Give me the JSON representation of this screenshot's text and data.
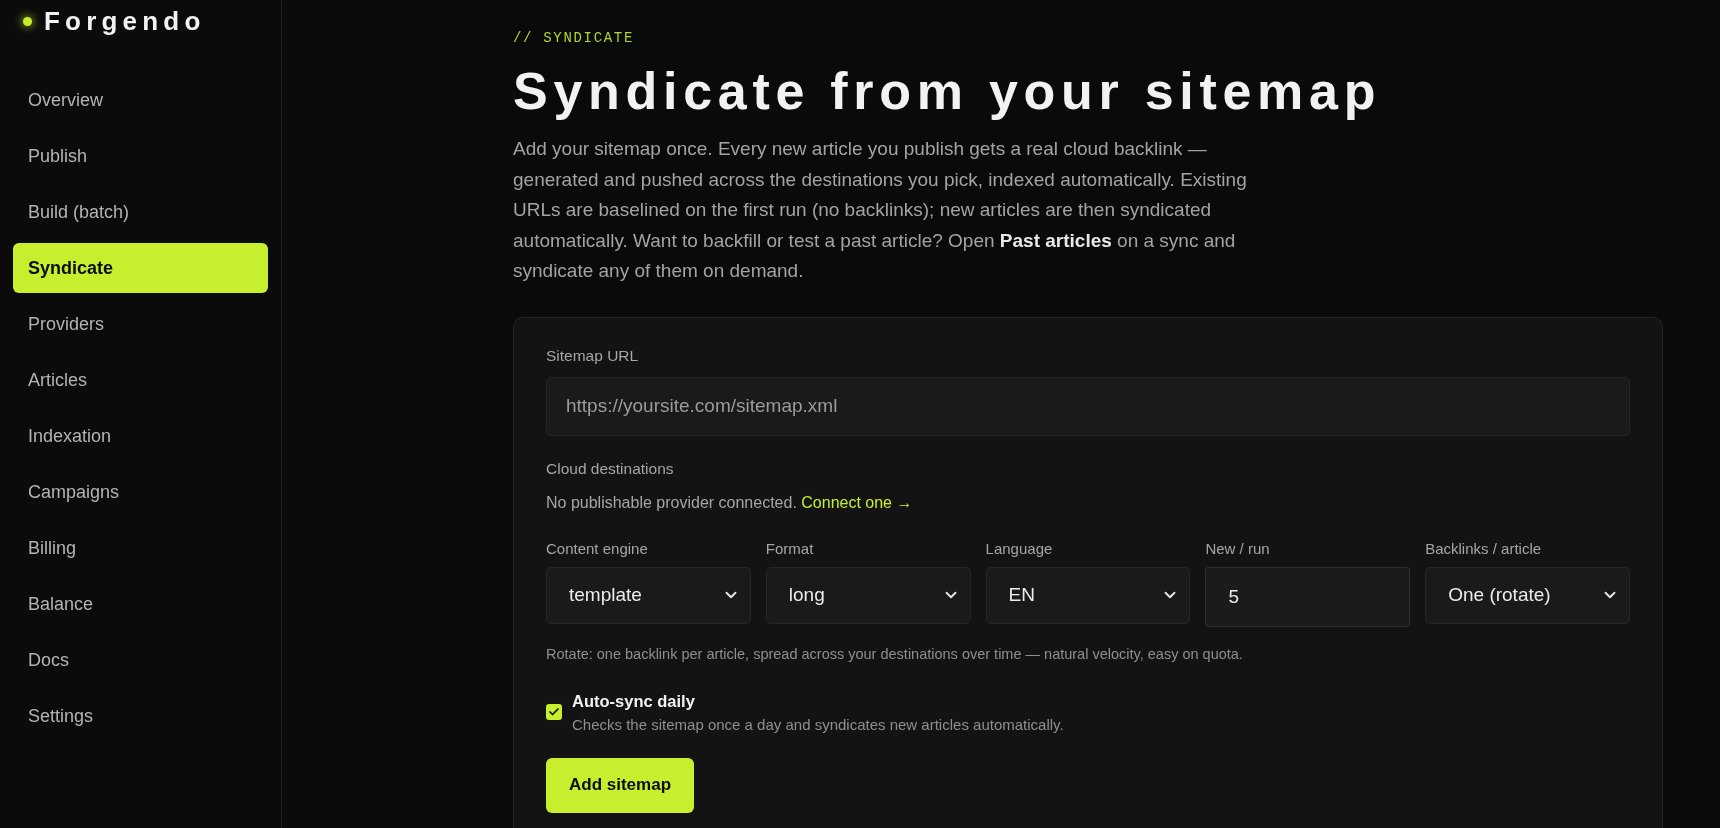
{
  "sidebar": {
    "logo": "Forgendo",
    "items": [
      {
        "label": "Overview",
        "selected": false
      },
      {
        "label": "Publish",
        "selected": false
      },
      {
        "label": "Build (batch)",
        "selected": false
      },
      {
        "label": "Syndicate",
        "selected": true
      },
      {
        "label": "Providers",
        "selected": false
      },
      {
        "label": "Articles",
        "selected": false
      },
      {
        "label": "Indexation",
        "selected": false
      },
      {
        "label": "Campaigns",
        "selected": false
      },
      {
        "label": "Billing",
        "selected": false
      },
      {
        "label": "Balance",
        "selected": false
      },
      {
        "label": "Docs",
        "selected": false
      },
      {
        "label": "Settings",
        "selected": false
      }
    ]
  },
  "header": {
    "eyebrow": "// SYNDICATE",
    "title": "Syndicate from your sitemap",
    "description": "Add your sitemap once. Every new article you publish gets a real cloud backlink — generated and pushed across the destinations you pick, indexed automatically. Existing URLs are baselined on the first run (no backlinks); new articles are then syndicated automatically. Want to backfill or test a past article? Open **Past articles** on a sync and syndicate any of them on demand."
  },
  "form": {
    "sitemap_url": {
      "label": "Sitemap URL",
      "placeholder": "https://yoursite.com/sitemap.xml"
    },
    "cloud_destinations": {
      "label": "Cloud destinations",
      "message": "No publishable provider connected.",
      "link": "Connect one →"
    },
    "settings": [
      {
        "label": "Content engine",
        "kind": "select",
        "value": "template"
      },
      {
        "label": "Format",
        "kind": "select",
        "value": "long"
      },
      {
        "label": "Language",
        "kind": "select",
        "value": "EN"
      },
      {
        "label": "New / run",
        "kind": "number",
        "value": "5"
      },
      {
        "label": "Backlinks / article",
        "kind": "select",
        "value": "One (rotate)"
      }
    ],
    "hint": "Rotate: one backlink per article, spread across your destinations over time — natural velocity, easy on quota.",
    "auto_sync": {
      "label": "Auto-sync daily",
      "description": "Checks the sitemap once a day and syndicates new articles automatically.",
      "checked": true
    },
    "submit": "Add sitemap"
  }
}
